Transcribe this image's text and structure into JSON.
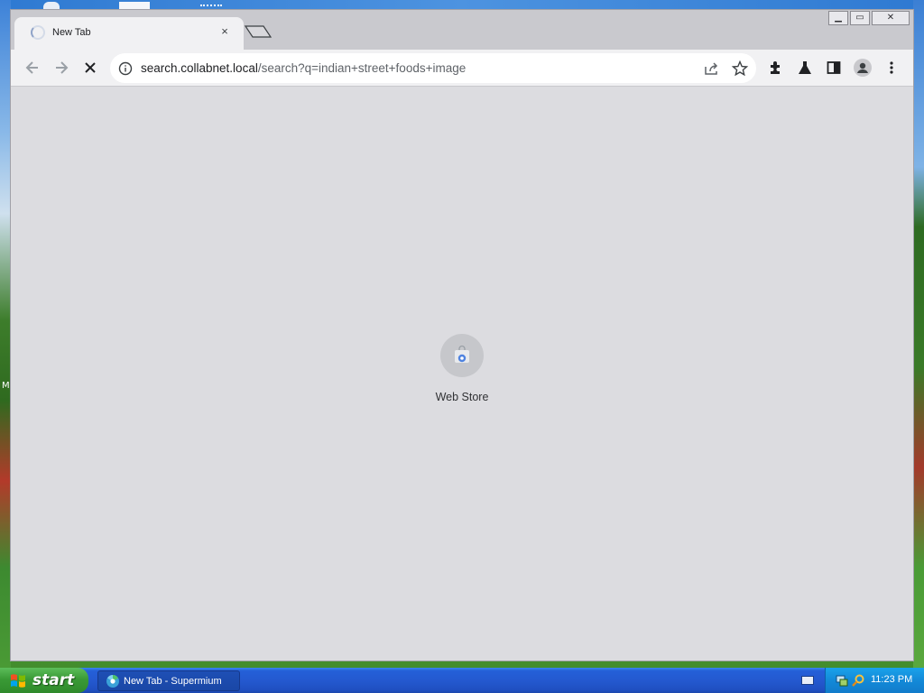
{
  "browser": {
    "tab": {
      "title": "New Tab",
      "close_label": "×"
    },
    "window_controls": {
      "minimize": "▁",
      "maximize": "▭",
      "close": "✕"
    },
    "address": {
      "host": "search.collabnet.local",
      "path": "/search?q=indian+street+foods+image"
    },
    "toolbar_icons": [
      "back-icon",
      "forward-icon",
      "stop-icon",
      "site-info-icon",
      "share-icon",
      "star-icon",
      "extensions-icon",
      "labs-icon",
      "side-panel-icon",
      "profile-icon",
      "menu-icon"
    ]
  },
  "page": {
    "shortcut_label": "Web Store"
  },
  "taskbar": {
    "start_label": "start",
    "task_label": "New Tab - Supermium",
    "clock": "11:23 PM"
  },
  "desktop": {
    "edge_letter": "M"
  },
  "colors": {
    "window_bg": "#dcdce0",
    "taskbar_blue": "#2459d0",
    "start_green": "#3a9a36",
    "tray_blue": "#138ad8"
  }
}
